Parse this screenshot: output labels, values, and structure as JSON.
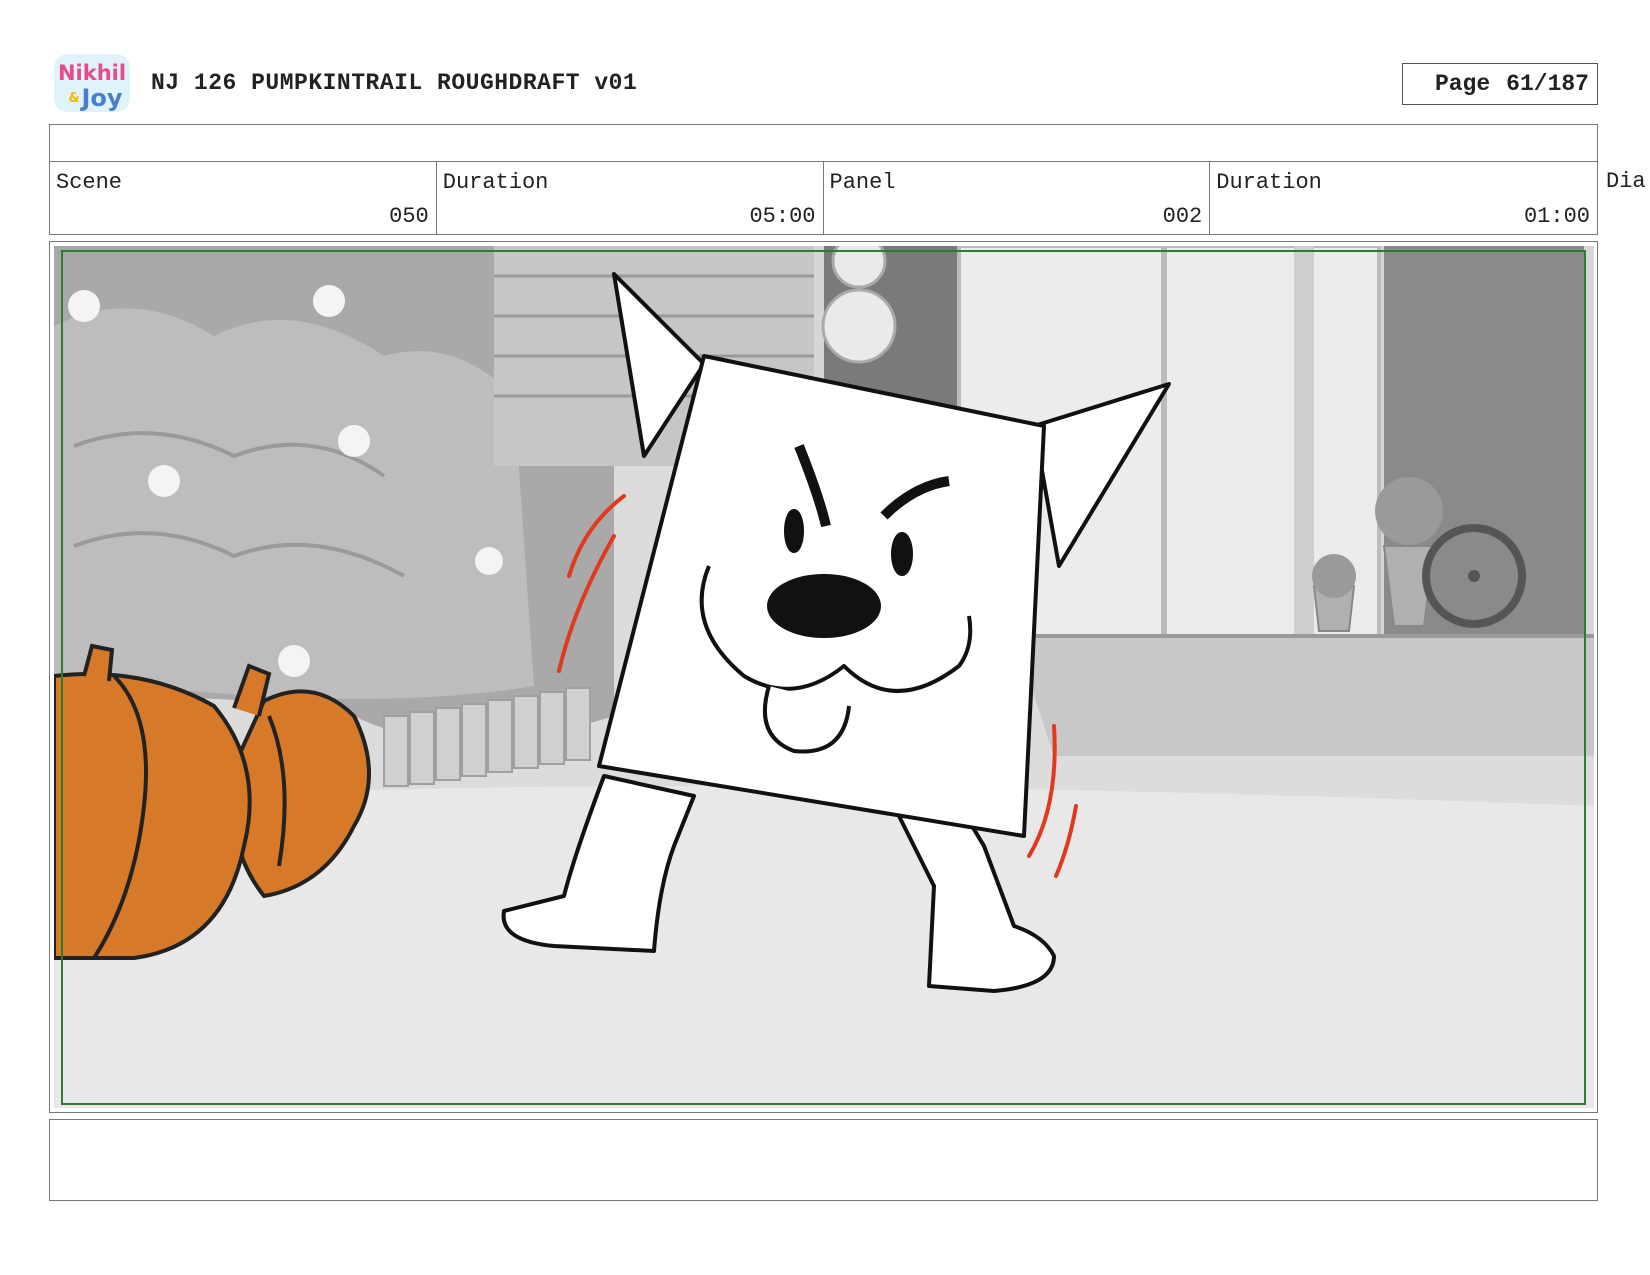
{
  "header": {
    "logo_text": "Nikhil & Joy",
    "title": "NJ 126 PUMPKINTRAIL ROUGHDRAFT v01",
    "page_label": "Page",
    "page_value": "61/187"
  },
  "fields": {
    "scene_label": "Scene",
    "scene_value": "050",
    "scene_duration_label": "Duration",
    "scene_duration_value": "05:00",
    "panel_label": "Panel",
    "panel_value": "002",
    "panel_duration_label": "Duration",
    "panel_duration_value": "01:00",
    "dialogue_label": "Dia"
  },
  "colors": {
    "safe_frame": "#2e7d32",
    "pumpkin": "#d67a2a",
    "motion_lines": "#e03a1e"
  },
  "notes": ""
}
